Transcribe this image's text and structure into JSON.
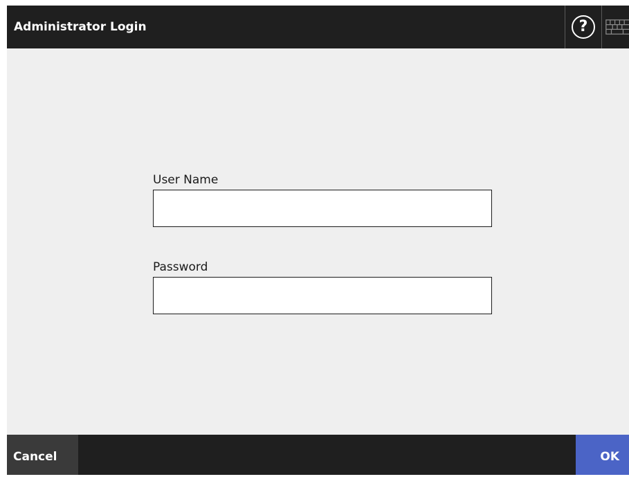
{
  "header": {
    "title": "Administrator Login",
    "help_icon": "help-icon",
    "help_glyph": "?",
    "keyboard_icon": "keyboard-icon"
  },
  "form": {
    "username": {
      "label": "User Name",
      "value": "",
      "placeholder": ""
    },
    "password": {
      "label": "Password",
      "value": "",
      "placeholder": ""
    }
  },
  "footer": {
    "cancel_label": "Cancel",
    "ok_label": "OK"
  },
  "colors": {
    "header_bg": "#1f1f1f",
    "content_bg": "#efefef",
    "cancel_bg": "#3a3a3a",
    "ok_accent": "#4b64c6"
  }
}
